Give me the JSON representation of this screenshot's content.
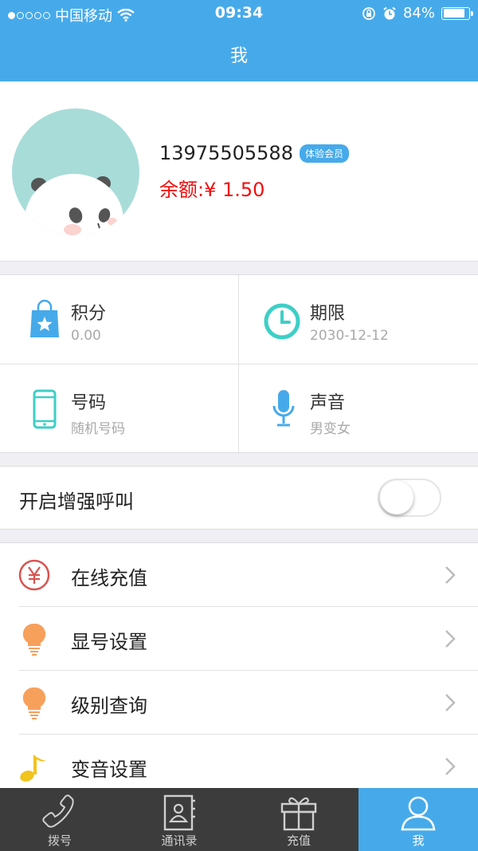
{
  "status_bar": {
    "carrier": "中国移动",
    "signal_dots_filled": 1,
    "signal_dots_total": 5,
    "time": "09:34",
    "battery": "84%",
    "battery_level": 0.84
  },
  "nav": {
    "title": "我"
  },
  "profile": {
    "phone": "13975505588",
    "badge": "体验会员",
    "balance": "余额:¥ 1.50"
  },
  "stats": [
    {
      "title": "积分",
      "subtitle": "0.00",
      "icon": "shopping-bag-star-icon"
    },
    {
      "title": "期限",
      "subtitle": "2030-12-12",
      "icon": "clock-icon"
    },
    {
      "title": "号码",
      "subtitle": "随机号码",
      "icon": "mobile-phone-icon"
    },
    {
      "title": "声音",
      "subtitle": "男变女",
      "icon": "microphone-icon"
    }
  ],
  "enhanced_call": {
    "label": "开启增强呼叫",
    "enabled": false
  },
  "menu": [
    {
      "label": "在线充值",
      "icon": "yen-circle-icon"
    },
    {
      "label": "显号设置",
      "icon": "lightbulb-icon"
    },
    {
      "label": "级别查询",
      "icon": "lightbulb-icon"
    },
    {
      "label": "变音设置",
      "icon": "music-note-icon"
    }
  ],
  "tabs": [
    {
      "label": "拨号",
      "icon": "phone-handset-icon",
      "active": false
    },
    {
      "label": "通讯录",
      "icon": "contacts-book-icon",
      "active": false
    },
    {
      "label": "充值",
      "icon": "gift-box-icon",
      "active": false
    },
    {
      "label": "我",
      "icon": "user-icon",
      "active": true
    }
  ],
  "colors": {
    "primary": "#46aaea",
    "balance_red": "#f20d0d",
    "tabbar_bg": "#3c3c3c",
    "accent_teal": "#3dcfc6",
    "accent_orange": "#f7a05c",
    "accent_yellow": "#f0c31d",
    "accent_red_icon": "#d9534f"
  }
}
